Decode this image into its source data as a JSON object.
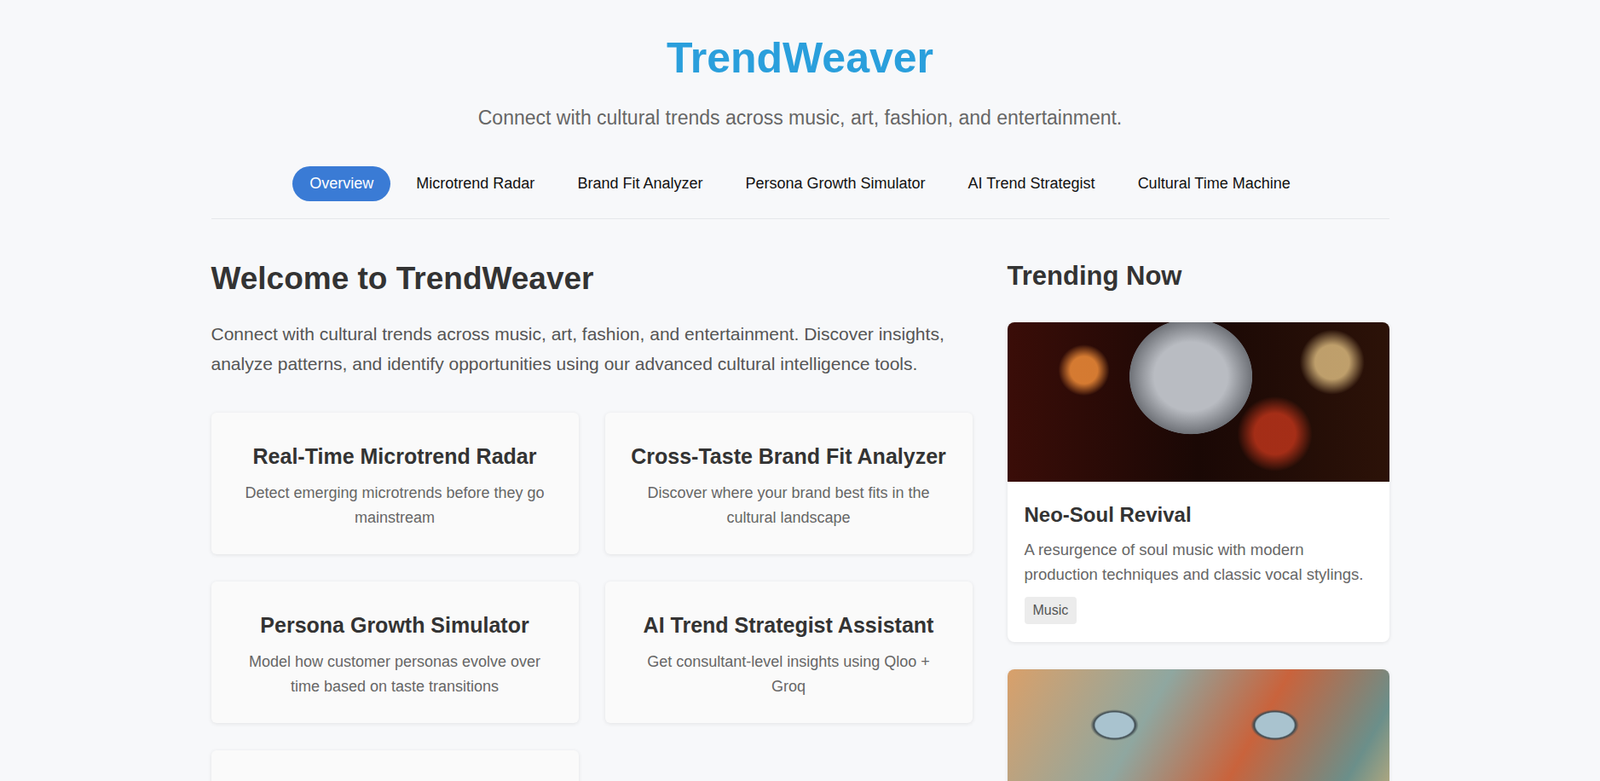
{
  "app": {
    "title": "TrendWeaver",
    "subtitle": "Connect with cultural trends across music, art, fashion, and entertainment."
  },
  "tabs": [
    {
      "label": "Overview",
      "selected": true
    },
    {
      "label": "Microtrend Radar",
      "selected": false
    },
    {
      "label": "Brand Fit Analyzer",
      "selected": false
    },
    {
      "label": "Persona Growth Simulator",
      "selected": false
    },
    {
      "label": "AI Trend Strategist",
      "selected": false
    },
    {
      "label": "Cultural Time Machine",
      "selected": false
    }
  ],
  "welcome": {
    "heading": "Welcome to TrendWeaver",
    "body": "Connect with cultural trends across music, art, fashion, and entertainment. Discover insights, analyze patterns, and identify opportunities using our advanced cultural intelligence tools."
  },
  "features": [
    {
      "kind": "full",
      "title": "Real-Time Microtrend Radar",
      "description": "Detect emerging microtrends before they go mainstream"
    },
    {
      "kind": "full",
      "title": "Cross-Taste Brand Fit Analyzer",
      "description": "Discover where your brand best fits in the cultural landscape"
    },
    {
      "kind": "full",
      "title": "Persona Growth Simulator",
      "description": "Model how customer personas evolve over time based on taste transitions"
    },
    {
      "kind": "full",
      "title": "AI Trend Strategist Assistant",
      "description": "Get consultant-level insights using Qloo + Groq"
    },
    {
      "kind": "cut-off"
    }
  ],
  "trending": {
    "heading": "Trending Now",
    "items": [
      {
        "kind": "full",
        "title": "Neo-Soul Revival",
        "description": "A resurgence of soul music with modern production techniques and classic vocal stylings.",
        "tag": "Music"
      },
      {
        "kind": "cut-off"
      }
    ]
  }
}
